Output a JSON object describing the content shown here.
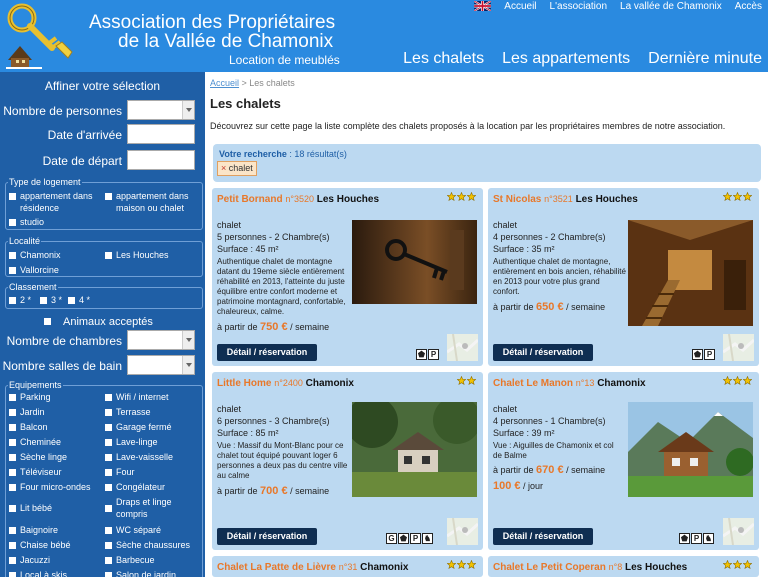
{
  "header": {
    "brand_line1": "Association des Propriétaires",
    "brand_line2": "de la Vallée de Chamonix",
    "brand_subtitle": "Location de meublés",
    "top_nav": [
      "Accueil",
      "L'association",
      "La vallée de Chamonix",
      "Accès"
    ],
    "main_nav": [
      "Les chalets",
      "Les appartements",
      "Dernière minute"
    ]
  },
  "sidebar": {
    "title": "Affiner votre sélection",
    "nb_personnes_label": "Nombre de personnes",
    "date_arrivee_label": "Date d'arrivée",
    "date_depart_label": "Date de départ",
    "type_logement": {
      "legend": "Type de logement",
      "options": [
        "appartement dans résidence",
        "appartement dans maison ou chalet",
        "studio"
      ]
    },
    "localite": {
      "legend": "Localité",
      "options": [
        "Chamonix",
        "Les Houches",
        "Vallorcine"
      ]
    },
    "classement": {
      "legend": "Classement",
      "options": [
        "2 *",
        "3 *",
        "4 *"
      ]
    },
    "animaux_label": "Animaux acceptés",
    "nb_chambres_label": "Nombre de chambres",
    "nb_sdb_label": "Nombre salles de bain",
    "equipements": {
      "legend": "Equipements",
      "options": [
        "Parking",
        "Wifi / internet",
        "Jardin",
        "Terrasse",
        "Balcon",
        "Garage fermé",
        "Cheminée",
        "Lave-linge",
        "Sèche linge",
        "Lave-vaisselle",
        "Téléviseur",
        "Four",
        "Four micro-ondes",
        "Congélateur",
        "Lit bébé",
        "Draps et linge compris",
        "Baignoire",
        "WC séparé",
        "Chaise bébé",
        "Sèche chaussures",
        "Jacuzzi",
        "Barbecue",
        "Local à skis",
        "Salon de jardin"
      ]
    }
  },
  "content": {
    "breadcrumb_home": "Accueil",
    "breadcrumb_sep": " > ",
    "breadcrumb_current": "Les chalets",
    "title": "Les chalets",
    "intro": "Découvrez sur cette page la liste complète des chalets proposés à la location par les propriétaires membres de notre association.",
    "search_label": "Votre recherche",
    "search_count": " : 18 résultat(s)",
    "search_tag": "chalet",
    "search_tag_remove": "×"
  },
  "listings": [
    {
      "name": "Petit Bornand",
      "number": "n°3520",
      "town": "Les Houches",
      "stars": 3,
      "type": "chalet",
      "capacity": "5 personnes - 2 Chambre(s)",
      "surface": "Surface : 45 m²",
      "description": "Authentique chalet de montagne datant du 19eme siècle entièrement réhabilité en 2013, l'atteinte du juste équilibre entre confort moderne et patrimoine montagnard, confortable, chaleureux, calme.",
      "price_prefix": "à partir de ",
      "price": "750 €",
      "price_suffix": " / semaine",
      "button": "Détail / réservation",
      "amenities": [
        "⬟",
        "P"
      ]
    },
    {
      "name": "St Nicolas",
      "number": "n°3521",
      "town": "Les Houches",
      "stars": 3,
      "type": "chalet",
      "capacity": "4 personnes - 2 Chambre(s)",
      "surface": "Surface : 35 m²",
      "description": "Authentique chalet de montagne, entièrement en bois ancien, réhabilité en 2013 pour votre plus grand confort.",
      "price_prefix": "à partir de ",
      "price": "650 €",
      "price_suffix": " / semaine",
      "button": "Détail / réservation",
      "amenities": [
        "⬟",
        "P"
      ]
    },
    {
      "name": "Little Home",
      "number": "n°2400",
      "town": "Chamonix",
      "stars": 2,
      "type": "chalet",
      "capacity": "6 personnes - 3 Chambre(s)",
      "surface": "Surface : 85 m²",
      "description": "Vue : Massif du Mont-Blanc pour ce chalet tout équipé pouvant loger 6 personnes a deux pas du centre ville au calme",
      "price_prefix": "à partir de ",
      "price": "700 €",
      "price_suffix": " / semaine",
      "button": "Détail / réservation",
      "amenities": [
        "G",
        "⬟",
        "P",
        "♞"
      ]
    },
    {
      "name": "Chalet Le Manon",
      "number": "n°13",
      "town": "Chamonix",
      "stars": 3,
      "type": "chalet",
      "capacity": "4 personnes - 1 Chambre(s)",
      "surface": "Surface : 39 m²",
      "description": "Vue : Aiguilles de Chamonix et col de Balme",
      "price_prefix": "à partir de ",
      "price": "670 €",
      "price_suffix": " / semaine",
      "price2": "100 €",
      "price2_suffix": " / jour",
      "button": "Détail / réservation",
      "amenities": [
        "⬟",
        "P",
        "♞"
      ]
    },
    {
      "name": "Chalet La Patte de Lièvre",
      "number": "n°31",
      "town": "Chamonix",
      "stars": 3
    },
    {
      "name": "Chalet Le Petit Coperan",
      "number": "n°8",
      "town": "Les Houches",
      "stars": 3
    }
  ],
  "colors": {
    "header": "#2a8ae0",
    "sidebar": "#1f5fa6",
    "card": "#bcd9f1",
    "accent": "#e8782a",
    "button": "#0f2e52"
  }
}
